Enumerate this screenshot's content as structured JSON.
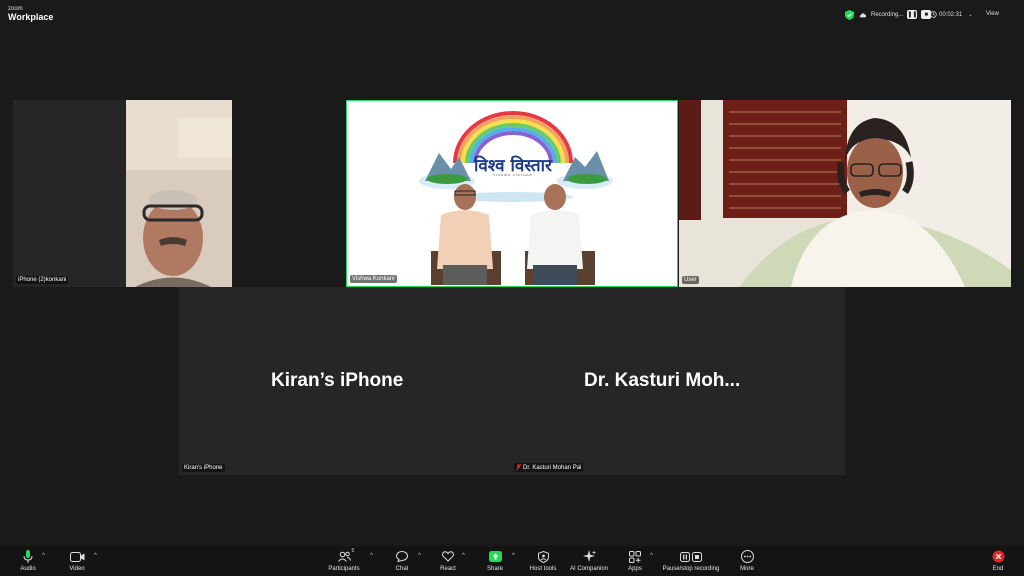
{
  "app": {
    "logo_small": "zoom",
    "logo_name": "Workplace"
  },
  "topbar": {
    "recording_label": "Recording...",
    "timer": "00:02:31",
    "view_label": "View"
  },
  "tiles": [
    {
      "label": "iPhone (2)konkani"
    },
    {
      "label": "Vishwa Konkani",
      "banner_title": "विश्व विस्तार",
      "banner_subtitle": "VISHWA VISTHAR"
    },
    {
      "label": "User"
    }
  ],
  "panels": [
    {
      "display_name": "Kiran’s iPhone",
      "label": "Kiran's iPhone"
    },
    {
      "display_name": "Dr. Kasturi Moh...",
      "label": "Dr. Kasturi Mohan Pai",
      "muted": true
    }
  ],
  "toolbar": {
    "audio": "Audio",
    "video": "Video",
    "participants": "Participants",
    "participants_count": "5",
    "chat": "Chat",
    "react": "React",
    "share": "Share",
    "host_tools": "Host tools",
    "ai_companion": "AI Companion",
    "apps": "Apps",
    "pause_stop": "Pause/stop recording",
    "more": "More",
    "end": "End"
  },
  "colors": {
    "active_speaker": "#23d959",
    "share": "#23d959",
    "end": "#e02828",
    "background": "#1a1a1a"
  }
}
